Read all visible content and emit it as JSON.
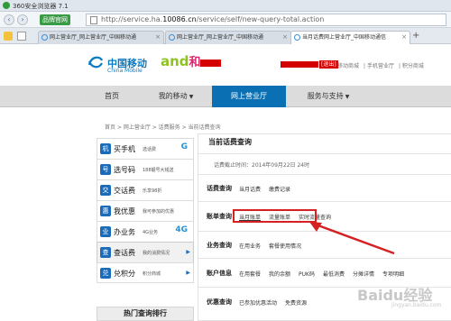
{
  "browser": {
    "title": "360安全浏览器 7.1",
    "badge": "品牌官网",
    "url_prefix": "http://service.ha.",
    "url_domain": "10086.cn",
    "url_suffix": "/service/self/new-query-total.action",
    "tabs": [
      {
        "label": "网上营业厅_网上营业厅_中国移动通"
      },
      {
        "label": "网上营业厅_网上营业厅_中国移动通"
      },
      {
        "label": "当月话费网上营业厅_中国移动通信"
      }
    ]
  },
  "header": {
    "brand_cn": "中国移动",
    "brand_en": "China Mobile",
    "and_logo": "and",
    "he_logo": "和",
    "logout": "[退出]",
    "links": [
      "移动商城",
      "手机营业厅",
      "积分商城"
    ]
  },
  "nav": {
    "items": [
      {
        "label": "首页"
      },
      {
        "label": "我的移动"
      },
      {
        "label": "网上营业厅"
      },
      {
        "label": "服务与支持"
      }
    ]
  },
  "breadcrumb": "首页 > 网上营业厅 > 话费服务 > 当前话费查询",
  "sidebar": {
    "items": [
      {
        "icon": "机",
        "name": "买手机",
        "sub": "选话费",
        "deco": "G"
      },
      {
        "icon": "号",
        "name": "选号码",
        "sub": "188靓号大钱送",
        "deco": ""
      },
      {
        "icon": "交",
        "name": "交话费",
        "sub": "乐享98折",
        "deco": ""
      },
      {
        "icon": "惠",
        "name": "我优惠",
        "sub": "我可参加的优惠",
        "deco": ""
      },
      {
        "icon": "业",
        "name": "办业务",
        "sub": "4G业务",
        "deco": "4G"
      },
      {
        "icon": "查",
        "name": "查话费",
        "sub": "我的消费情况",
        "deco": ""
      },
      {
        "icon": "兑",
        "name": "兑积分",
        "sub": "积分商城",
        "deco": ""
      }
    ],
    "hot_title": "热门查询排行"
  },
  "content": {
    "title": "当前话费查询",
    "date": "话费截止时间：2014年09月22日 24时",
    "rows": [
      {
        "label": "话费查询",
        "links": [
          "当月话费",
          "缴费记录"
        ]
      },
      {
        "label": "账单查询",
        "links": [
          "当月账单",
          "流量账单",
          "实时流量查询"
        ]
      },
      {
        "label": "业务查询",
        "links": [
          "在用业务",
          "套餐使用情况"
        ]
      },
      {
        "label": "账户信息",
        "links": [
          "在用套餐",
          "我的余额",
          "PUK码",
          "最低消费",
          "分摊详情",
          "专项明细"
        ]
      },
      {
        "label": "优惠查询",
        "links": [
          "已参加优惠活动",
          "免费资源"
        ]
      }
    ]
  },
  "watermark": "Baidu经验",
  "watermark_sub": "jingyan.baidu.com",
  "colors": {
    "nav_active": "#0b6fb4",
    "highlight": "#d42121",
    "brand_blue": "#0a7ac0"
  }
}
